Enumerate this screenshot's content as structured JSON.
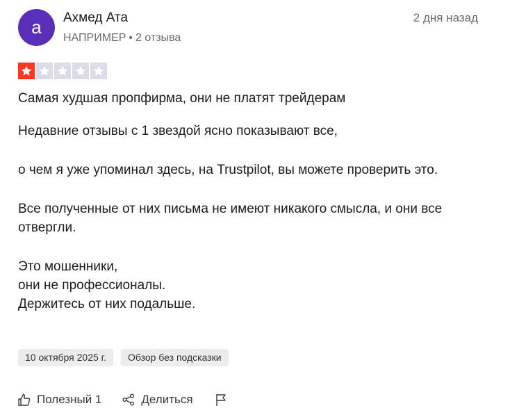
{
  "review": {
    "avatar_letter": "а",
    "author": "Ахмед Ата",
    "country": "НАПРИМЕР",
    "separator": "•",
    "reviews_count": "2 отзыва",
    "date_ago": "2 дня назад",
    "rating": 1,
    "rating_max": 5,
    "title": "Самая худшая пропфирма, они не платят трейдерам",
    "paragraphs": [
      "Недавние отзывы с 1 звездой ясно показывают все,",
      "о чем я уже упоминал здесь, на Trustpilot, вы можете проверить это.",
      "Все полученные от них письма не имеют никакого смысла, и они все отвергли.",
      "Это мошенники,\nони не профессионалы.\nДержитесь от них подальше."
    ],
    "experience_date": "10 октября 2025 г.",
    "unprompted_label": "Обзор без подсказки"
  },
  "actions": {
    "useful_label": "Полезный 1",
    "share_label": "Делиться"
  },
  "colors": {
    "avatar_bg": "#5a2fb8",
    "star_active": "#ff3722",
    "star_inactive": "#dcdce6"
  },
  "icons": [
    "thumbs-up-icon",
    "share-icon",
    "flag-icon",
    "star-icon"
  ]
}
